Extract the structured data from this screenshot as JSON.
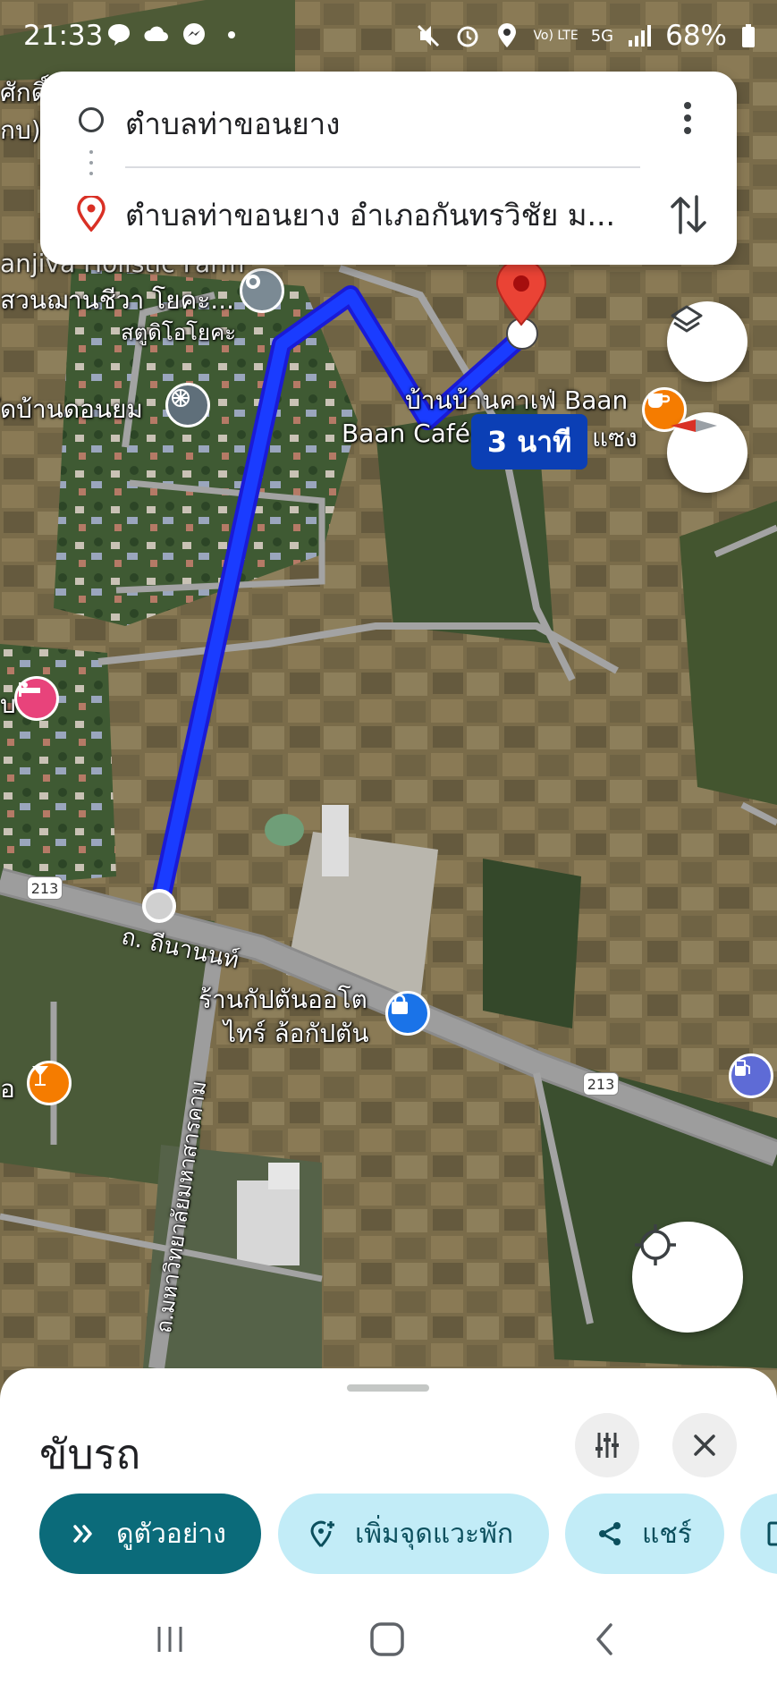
{
  "status_bar": {
    "time": "21:33",
    "network": "5G",
    "volte": "Vo) LTE",
    "battery": "68%"
  },
  "search": {
    "origin": "ตำบลท่าขอนยาง",
    "destination": "ตำบลท่าขอนยาง อำเภอกันทรวิชัย ม..."
  },
  "map": {
    "labels": {
      "top_left_1": "ศักดิ์",
      "top_left_2": "กบ)",
      "sanjiva_en": "anjiva Holistic Farm",
      "sanjiva_th": "สวนฌานชีวา โยคะ...",
      "studio": "สตูดิโอโยคะ",
      "temple": "ัดบ้านดอนยม",
      "cafe_th": "บ้านบ้านคาเฟ่ Baan",
      "cafe_en": "Baan Café",
      "cafe_tail": "แซง",
      "road_name": "ถ. ถีนานนท์",
      "shop_1": "ร้านกัปตันออโต",
      "shop_2": "ไทร์ ล้อกัปตัน",
      "univ_road": "ถ.มหาวิทยาลัยมหาสารคาม",
      "left_edge_1": "บ",
      "left_edge_2": "อ"
    },
    "route_shields": [
      "213",
      "213"
    ],
    "eta": "3 นาที",
    "colors": {
      "route": "#1a3cff",
      "destination_pin": "#ea4335",
      "cafe_poi": "#f57c00",
      "hotel_poi": "#e8437b",
      "bar_poi": "#f57c00",
      "shop_poi": "#1a73e8",
      "gas_poi": "#5e6bd6"
    }
  },
  "sheet": {
    "mode": "ขับรถ",
    "chips": {
      "preview": "ดูตัวอย่าง",
      "add_stop": "เพิ่มจุดแวะพัก",
      "share": "แชร์"
    }
  }
}
